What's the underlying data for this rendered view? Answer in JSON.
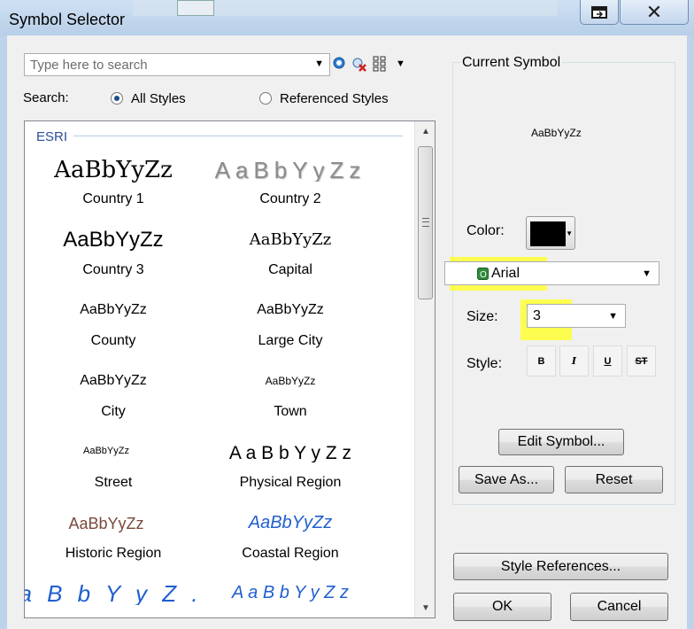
{
  "window": {
    "title": "Symbol Selector"
  },
  "search": {
    "placeholder": "Type here to search",
    "label": "Search:",
    "option_all": "All Styles",
    "option_referenced": "Referenced Styles"
  },
  "gallery": {
    "group": "ESRI",
    "symbols": [
      {
        "sample": "AaBbYyZz",
        "name": "Country 1",
        "color": "#000000"
      },
      {
        "sample": "AaBbYyZz",
        "name": "Country 2",
        "color": "#8c8c8c"
      },
      {
        "sample": "AaBbYyZz",
        "name": "Country 3",
        "color": "#000000"
      },
      {
        "sample": "AaBbYyZz",
        "name": "Capital",
        "color": "#000000"
      },
      {
        "sample": "AaBbYyZz",
        "name": "County",
        "color": "#000000"
      },
      {
        "sample": "AaBbYyZz",
        "name": "Large City",
        "color": "#000000"
      },
      {
        "sample": "AaBbYyZz",
        "name": "City",
        "color": "#000000"
      },
      {
        "sample": "AaBbYyZz",
        "name": "Town",
        "color": "#000000"
      },
      {
        "sample": "AaBbYyZz",
        "name": "Street",
        "color": "#000000"
      },
      {
        "sample": "A a B b Y y Z z",
        "name": "Physical Region",
        "color": "#000000"
      },
      {
        "sample": "AaBbYyZz",
        "name": "Historic Region",
        "color": "#7a4a3a"
      },
      {
        "sample": "AaBbYyZz",
        "name": "Coastal Region",
        "color": "#1f5fcf"
      },
      {
        "sample": "a B b Y y Z .",
        "name": "",
        "color": "#1f5fcf"
      },
      {
        "sample": "A a B b Y y Z z",
        "name": "",
        "color": "#1f5fcf"
      }
    ]
  },
  "current_symbol": {
    "title": "Current Symbol",
    "preview": "AaBbYyZz",
    "color_label": "Color:",
    "color_value": "#000000",
    "font": "Arial",
    "size_label": "Size:",
    "size": "3",
    "style_label": "Style:",
    "style_buttons": [
      "B",
      "I",
      "U",
      "ST"
    ],
    "edit_button": "Edit Symbol...",
    "save_button": "Save As...",
    "reset_button": "Reset"
  },
  "footer": {
    "style_references_button": "Style References...",
    "ok_button": "OK",
    "cancel_button": "Cancel"
  },
  "highlight_color": "#ffff33"
}
